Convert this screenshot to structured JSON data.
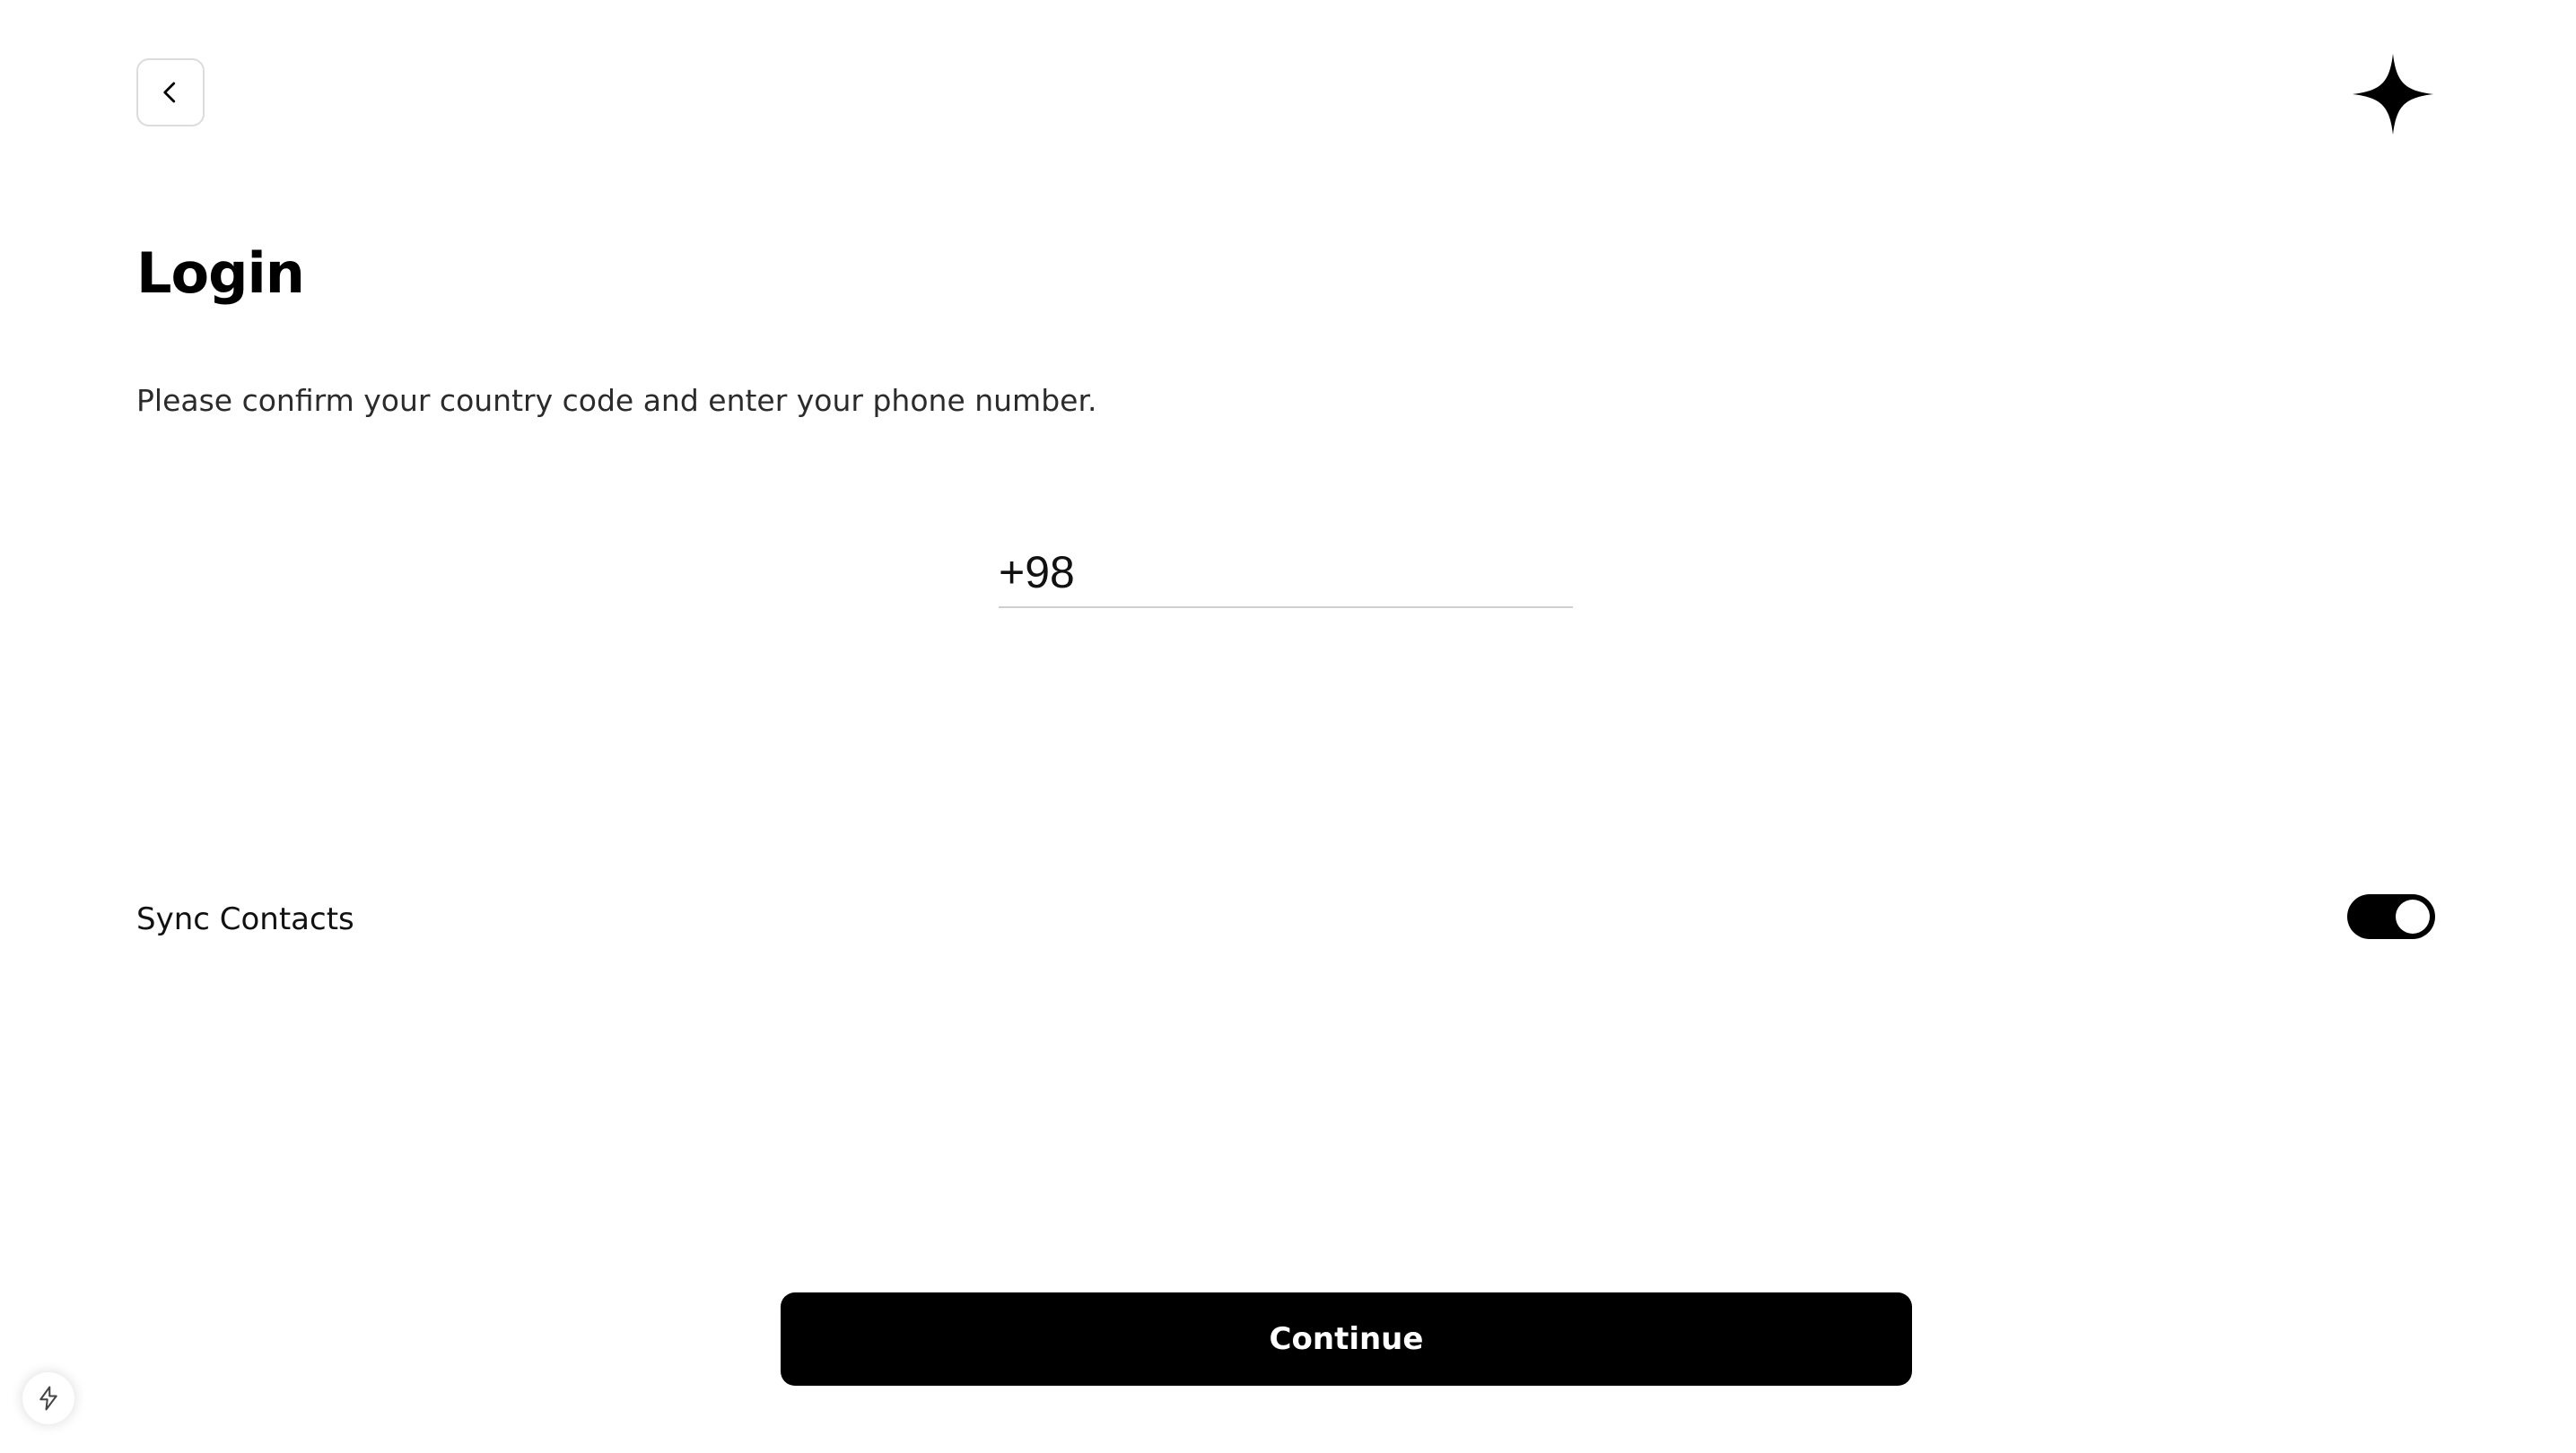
{
  "header": {
    "back_icon": "chevron-left-icon",
    "logo_icon": "sparkle-star-icon"
  },
  "page": {
    "title": "Login",
    "subtitle": "Please confirm your country code and enter your phone number."
  },
  "phone": {
    "value": "+98"
  },
  "sync": {
    "label": "Sync Contacts",
    "enabled": true
  },
  "actions": {
    "continue_label": "Continue"
  },
  "dev_badge": {
    "icon": "lightning-bolt-icon"
  },
  "colors": {
    "primary": "#000000",
    "background": "#ffffff",
    "border": "#dcdcdc"
  }
}
